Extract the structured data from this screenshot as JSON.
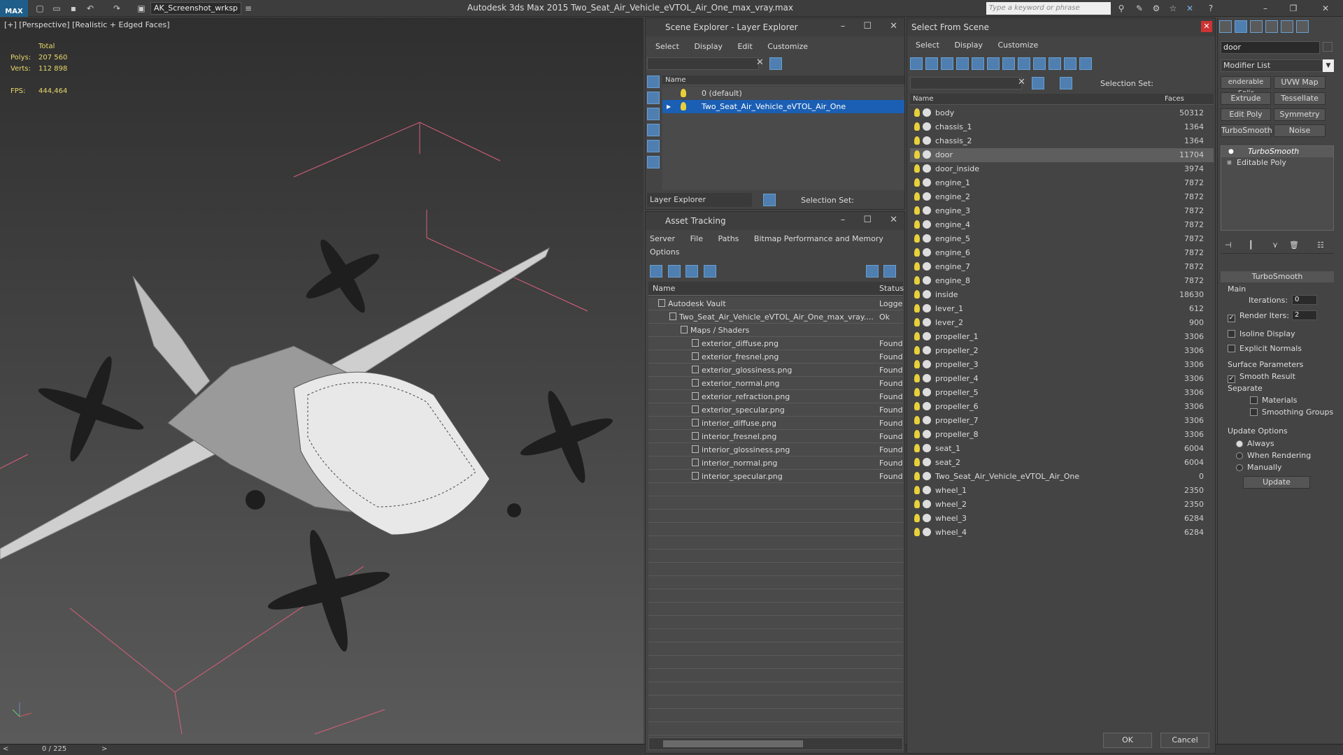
{
  "titlebar": {
    "logo": "MAX",
    "workspace": "AK_Screenshot_wrksp",
    "title": "Autodesk 3ds Max  2015    Two_Seat_Air_Vehicle_eVTOL_Air_One_max_vray.max",
    "search_placeholder": "Type a keyword or phrase"
  },
  "viewport": {
    "label": "[+] [Perspective] [Realistic + Edged Faces]",
    "stats_total": "Total",
    "polys_label": "Polys:",
    "polys_value": "207 560",
    "verts_label": "Verts:",
    "verts_value": "112 898",
    "fps_label": "FPS:",
    "fps_value": "444,464"
  },
  "timeline": {
    "frame": "0 / 225",
    "prev": "<",
    "next": ">"
  },
  "scene_explorer": {
    "title": "Scene Explorer - Layer Explorer",
    "menu": [
      "Select",
      "Display",
      "Edit",
      "Customize"
    ],
    "column": "Name",
    "layers": [
      "0 (default)",
      "Two_Seat_Air_Vehicle_eVTOL_Air_One"
    ],
    "footer_label": "Layer Explorer",
    "selection_set": "Selection Set:"
  },
  "asset_tracking": {
    "title": "Asset Tracking",
    "menu": [
      "Server",
      "File",
      "Paths",
      "Bitmap Performance and Memory"
    ],
    "menu2": "Options",
    "col_name": "Name",
    "col_status": "Status",
    "rows": [
      {
        "name": "Autodesk Vault",
        "status": "Logged",
        "indent": 0
      },
      {
        "name": "Two_Seat_Air_Vehicle_eVTOL_Air_One_max_vray....",
        "status": "Ok",
        "indent": 1
      },
      {
        "name": "Maps / Shaders",
        "status": "",
        "indent": 2
      },
      {
        "name": "exterior_diffuse.png",
        "status": "Found",
        "indent": 3
      },
      {
        "name": "exterior_fresnel.png",
        "status": "Found",
        "indent": 3
      },
      {
        "name": "exterior_glossiness.png",
        "status": "Found",
        "indent": 3
      },
      {
        "name": "exterior_normal.png",
        "status": "Found",
        "indent": 3
      },
      {
        "name": "exterior_refraction.png",
        "status": "Found",
        "indent": 3
      },
      {
        "name": "exterior_specular.png",
        "status": "Found",
        "indent": 3
      },
      {
        "name": "interior_diffuse.png",
        "status": "Found",
        "indent": 3
      },
      {
        "name": "interior_fresnel.png",
        "status": "Found",
        "indent": 3
      },
      {
        "name": "interior_glossiness.png",
        "status": "Found",
        "indent": 3
      },
      {
        "name": "interior_normal.png",
        "status": "Found",
        "indent": 3
      },
      {
        "name": "interior_specular.png",
        "status": "Found",
        "indent": 3
      }
    ]
  },
  "select_from_scene": {
    "title": "Select From Scene",
    "menu": [
      "Select",
      "Display",
      "Customize"
    ],
    "selection_set": "Selection Set:",
    "col_name": "Name",
    "col_faces": "Faces",
    "items": [
      {
        "name": "body",
        "faces": "50312"
      },
      {
        "name": "chassis_1",
        "faces": "1364"
      },
      {
        "name": "chassis_2",
        "faces": "1364"
      },
      {
        "name": "door",
        "faces": "11704",
        "selected": true
      },
      {
        "name": "door_inside",
        "faces": "3974"
      },
      {
        "name": "engine_1",
        "faces": "7872"
      },
      {
        "name": "engine_2",
        "faces": "7872"
      },
      {
        "name": "engine_3",
        "faces": "7872"
      },
      {
        "name": "engine_4",
        "faces": "7872"
      },
      {
        "name": "engine_5",
        "faces": "7872"
      },
      {
        "name": "engine_6",
        "faces": "7872"
      },
      {
        "name": "engine_7",
        "faces": "7872"
      },
      {
        "name": "engine_8",
        "faces": "7872"
      },
      {
        "name": "inside",
        "faces": "18630"
      },
      {
        "name": "lever_1",
        "faces": "612"
      },
      {
        "name": "lever_2",
        "faces": "900"
      },
      {
        "name": "propeller_1",
        "faces": "3306"
      },
      {
        "name": "propeller_2",
        "faces": "3306"
      },
      {
        "name": "propeller_3",
        "faces": "3306"
      },
      {
        "name": "propeller_4",
        "faces": "3306"
      },
      {
        "name": "propeller_5",
        "faces": "3306"
      },
      {
        "name": "propeller_6",
        "faces": "3306"
      },
      {
        "name": "propeller_7",
        "faces": "3306"
      },
      {
        "name": "propeller_8",
        "faces": "3306"
      },
      {
        "name": "seat_1",
        "faces": "6004"
      },
      {
        "name": "seat_2",
        "faces": "6004"
      },
      {
        "name": "Two_Seat_Air_Vehicle_eVTOL_Air_One",
        "faces": "0"
      },
      {
        "name": "wheel_1",
        "faces": "2350"
      },
      {
        "name": "wheel_2",
        "faces": "2350"
      },
      {
        "name": "wheel_3",
        "faces": "6284"
      },
      {
        "name": "wheel_4",
        "faces": "6284"
      }
    ],
    "ok": "OK",
    "cancel": "Cancel"
  },
  "command_panel": {
    "object_name": "door",
    "modifier_list": "Modifier List",
    "buttons": [
      "enderable Splir",
      "UVW Map",
      "Extrude",
      "Tessellate",
      "Edit Poly",
      "Symmetry",
      "TurboSmooth",
      "Noise"
    ],
    "stack": [
      "TurboSmooth",
      "Editable Poly"
    ],
    "rollout_title": "TurboSmooth",
    "main": "Main",
    "iterations_label": "Iterations:",
    "iterations_value": "0",
    "render_iters_label": "Render Iters:",
    "render_iters_value": "2",
    "isoline": "Isoline Display",
    "explicit_normals": "Explicit Normals",
    "surface_params": "Surface Parameters",
    "smooth_result": "Smooth Result",
    "separate": "Separate",
    "materials": "Materials",
    "smoothing_groups": "Smoothing Groups",
    "update_options": "Update Options",
    "always": "Always",
    "when_rendering": "When Rendering",
    "manually": "Manually",
    "update": "Update"
  },
  "colors": {
    "selection": "#1a5fb4",
    "accent": "#4f7fb0"
  }
}
